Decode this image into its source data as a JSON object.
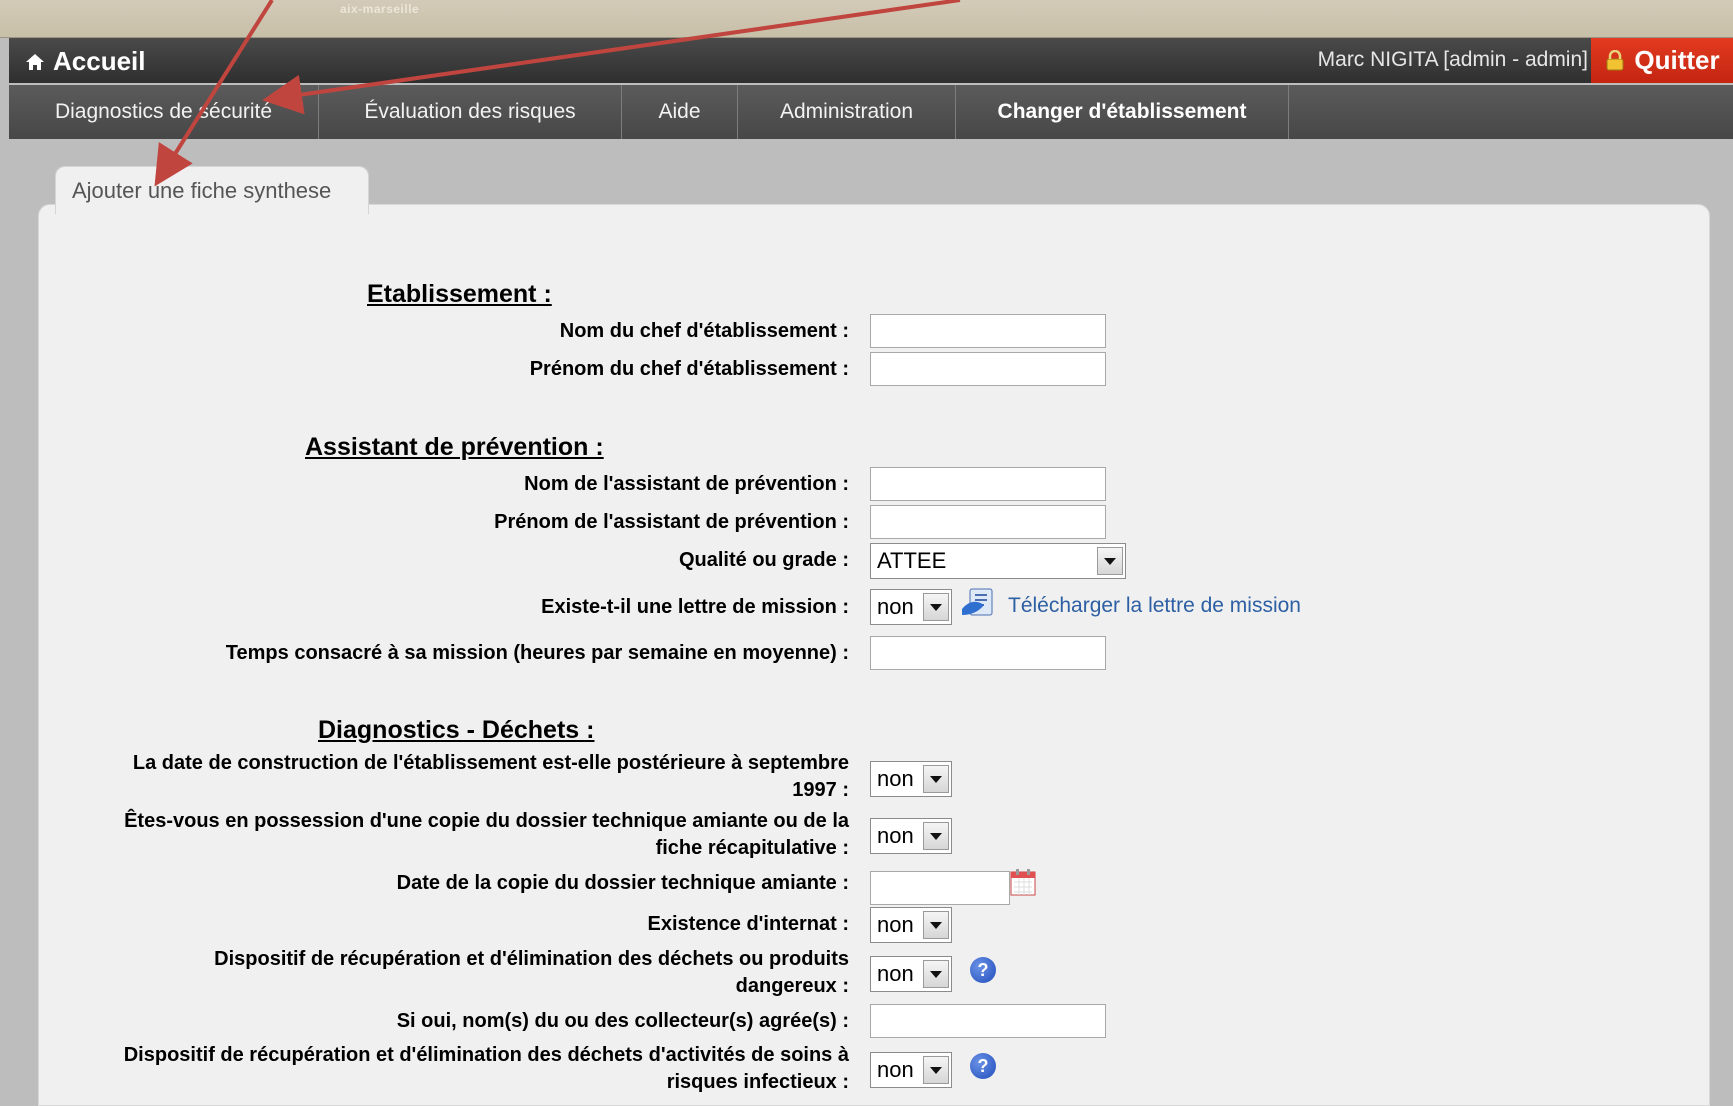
{
  "header": {
    "logo_text": "aix-marseille",
    "home_label": "Accueil",
    "user_text": "Marc NIGITA [admin - admin]",
    "quit_label": "Quitter"
  },
  "menu": [
    {
      "label": "Diagnostics de sécurité"
    },
    {
      "label": "Évaluation des risques"
    },
    {
      "label": "Aide"
    },
    {
      "label": "Administration"
    },
    {
      "label": "Changer d'établissement"
    }
  ],
  "tab": {
    "label": "Ajouter une fiche synthese"
  },
  "sections": {
    "etablissement": "Etablissement :",
    "assistant": "Assistant de prévention :",
    "dechets": "Diagnostics - Déchets :"
  },
  "fields": {
    "nom_chef": {
      "label": "Nom du chef d'établissement :",
      "value": ""
    },
    "prenom_chef": {
      "label": "Prénom du chef d'établissement :",
      "value": ""
    },
    "nom_assistant": {
      "label": "Nom de l'assistant de prévention :",
      "value": ""
    },
    "prenom_assistant": {
      "label": "Prénom de l'assistant de prévention :",
      "value": ""
    },
    "qualite": {
      "label": "Qualité ou grade :",
      "value": "ATTEE"
    },
    "lettre_mission": {
      "label": "Existe-t-il une lettre de mission :",
      "value": "non",
      "link": "Télécharger la lettre de mission"
    },
    "temps_mission": {
      "label": "Temps consacré à sa mission (heures par semaine en moyenne) :",
      "value": ""
    },
    "date_construction": {
      "label1": "La date de construction de l'établissement est-elle postérieure à septembre",
      "label2": "1997 :",
      "value": "non"
    },
    "copie_dta": {
      "label1": "Êtes-vous en possession d'une copie du dossier technique amiante ou de la",
      "label2": "fiche récapitulative :",
      "value": "non"
    },
    "date_copie_dta": {
      "label": "Date de la copie du dossier technique amiante :",
      "value": ""
    },
    "internat": {
      "label": "Existence d'internat :",
      "value": "non"
    },
    "dispositif_dangereux": {
      "label1": "Dispositif de récupération et d'élimination des déchets ou produits",
      "label2": "dangereux :",
      "value": "non"
    },
    "collecteurs": {
      "label": "Si oui, nom(s) du ou des collecteur(s) agrée(s) :",
      "value": ""
    },
    "dispositif_dasri": {
      "label1": "Dispositif de récupération et d'élimination des déchets d'activités de soins à",
      "label2": "risques infectieux :",
      "value": "non"
    }
  },
  "colors": {
    "titlebar": "#3a3a3a",
    "menubar": "#4f4f4f",
    "quit": "#d2301a",
    "annotation_arrow": "#c0453f",
    "link": "#2c5fa3"
  }
}
